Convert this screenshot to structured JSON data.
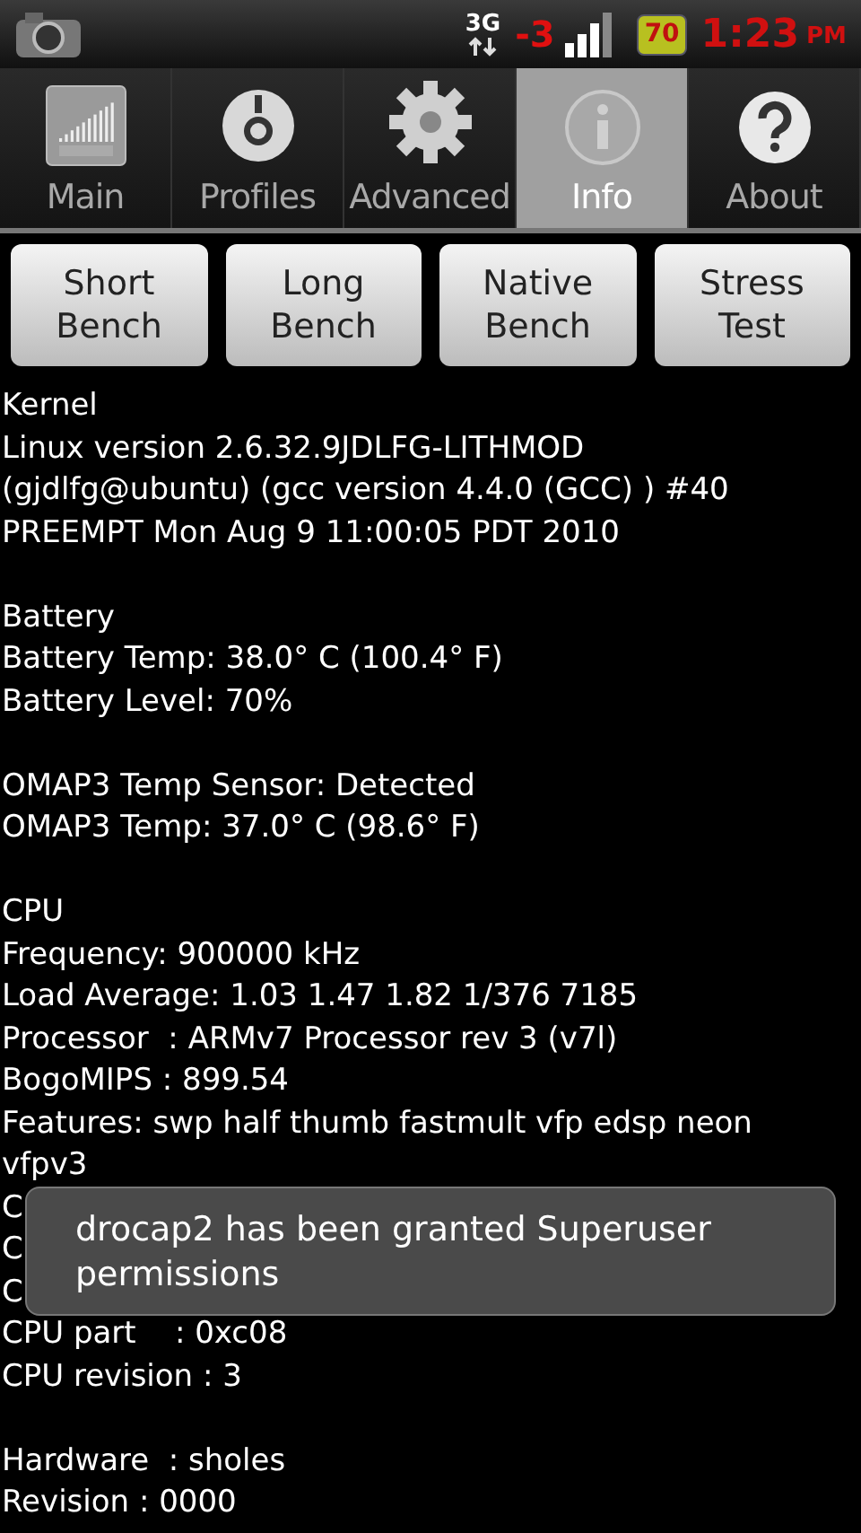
{
  "status_bar": {
    "network": "3G",
    "signal_delta": "-3",
    "battery": "70",
    "time": "1:23",
    "meridiem": "PM"
  },
  "tabs": [
    {
      "label": "Main",
      "kind": "main",
      "selected": false
    },
    {
      "label": "Profiles",
      "kind": "profiles",
      "selected": false
    },
    {
      "label": "Advanced",
      "kind": "advanced",
      "selected": false
    },
    {
      "label": "Info",
      "kind": "info",
      "selected": true
    },
    {
      "label": "About",
      "kind": "about",
      "selected": false
    }
  ],
  "buttons": [
    [
      "Short",
      "Bench"
    ],
    [
      "Long",
      "Bench"
    ],
    [
      "Native",
      "Bench"
    ],
    [
      "Stress",
      "Test"
    ]
  ],
  "sections": [
    {
      "lines": [
        "Kernel",
        "Linux version 2.6.32.9JDLFG-LITHMOD",
        "(gjdlfg@ubuntu) (gcc version 4.4.0 (GCC) ) #40",
        "PREEMPT Mon Aug 9 11:00:05 PDT 2010"
      ]
    },
    {
      "lines": [
        "Battery",
        "Battery Temp: 38.0° C (100.4° F)",
        "Battery Level: 70%"
      ]
    },
    {
      "lines": [
        "OMAP3 Temp Sensor: Detected",
        "OMAP3 Temp: 37.0° C (98.6° F)"
      ]
    },
    {
      "lines": [
        "CPU",
        "Frequency: 900000 kHz",
        "Load Average: 1.03 1.47 1.82 1/376 7185",
        "Processor  : ARMv7 Processor rev 3 (v7l)",
        "BogoMIPS : 899.54",
        "Features: swp half thumb fastmult vfp edsp neon vfpv3",
        "C",
        "C",
        "C",
        "CPU part    : 0xc08",
        "CPU revision : 3"
      ]
    },
    {
      "lines": [
        "Hardware  : sholes",
        "Revision : 0000"
      ]
    }
  ],
  "toast": {
    "text": "drocap2 has been granted Superuser permissions"
  }
}
